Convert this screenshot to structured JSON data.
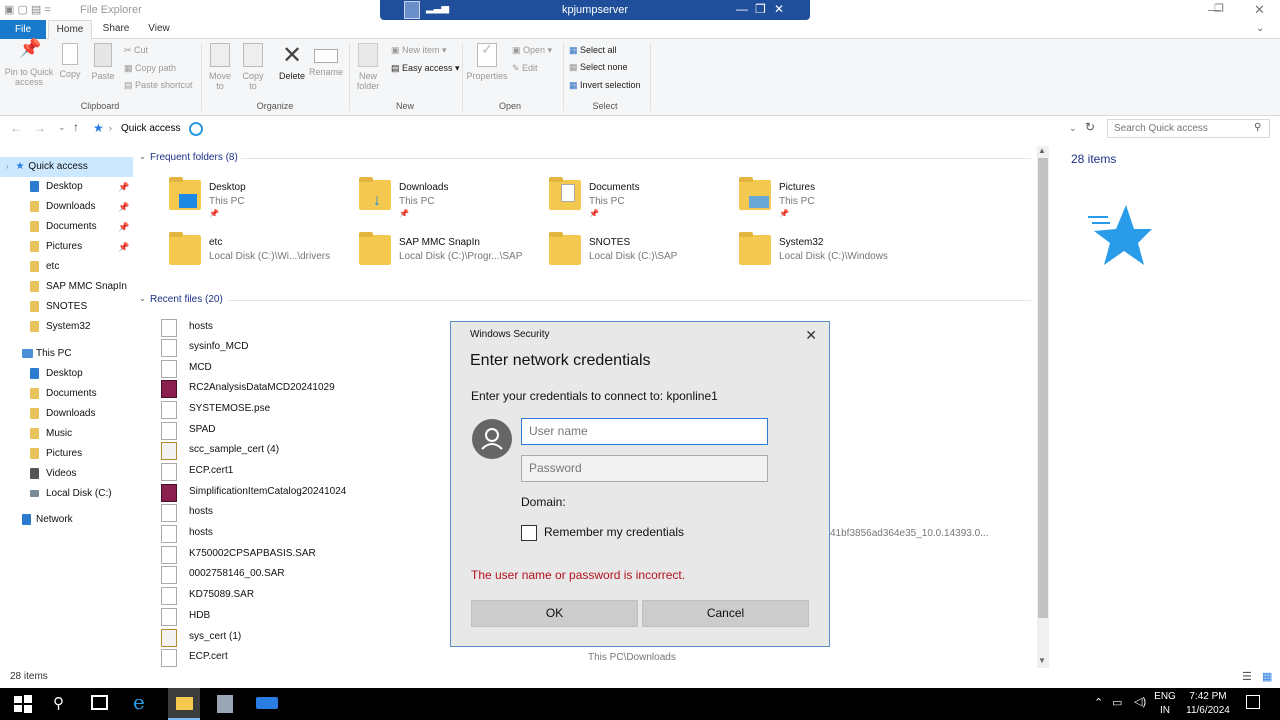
{
  "window": {
    "title": "File Explorer",
    "remote_title": "kpjumpserver"
  },
  "ribbon_tabs": [
    "File",
    "Home",
    "Share",
    "View"
  ],
  "ribbon": {
    "clipboard": {
      "pin": "Pin to Quick access",
      "copy": "Copy",
      "paste": "Paste",
      "cut": "Cut",
      "copy_path": "Copy path",
      "paste_shortcut": "Paste shortcut",
      "label": "Clipboard"
    },
    "organize": {
      "move_to": "Move to",
      "copy_to": "Copy to",
      "delete": "Delete",
      "rename": "Rename",
      "label": "Organize"
    },
    "new": {
      "new_folder": "New folder",
      "new_item": "New item",
      "easy_access": "Easy access",
      "label": "New"
    },
    "open": {
      "properties": "Properties",
      "open": "Open",
      "edit": "Edit",
      "label": "Open"
    },
    "select": {
      "select_all": "Select all",
      "select_none": "Select none",
      "invert": "Invert selection",
      "label": "Select"
    }
  },
  "address": {
    "path": "Quick access",
    "search_placeholder": "Search Quick access"
  },
  "nav": {
    "quick_access": "Quick access",
    "quick_items": [
      "Desktop",
      "Downloads",
      "Documents",
      "Pictures",
      "etc",
      "SAP MMC SnapIn",
      "SNOTES",
      "System32"
    ],
    "this_pc": "This PC",
    "pc_items": [
      "Desktop",
      "Documents",
      "Downloads",
      "Music",
      "Pictures",
      "Videos",
      "Local Disk (C:)"
    ],
    "network": "Network"
  },
  "frequent": {
    "header": "Frequent folders (8)",
    "items": [
      {
        "name": "Desktop",
        "loc": "This PC"
      },
      {
        "name": "Downloads",
        "loc": "This PC"
      },
      {
        "name": "Documents",
        "loc": "This PC"
      },
      {
        "name": "Pictures",
        "loc": "This PC"
      },
      {
        "name": "etc",
        "loc": "Local Disk (C:)\\Wi...\\drivers"
      },
      {
        "name": "SAP MMC SnapIn",
        "loc": "Local Disk (C:)\\Progr...\\SAP"
      },
      {
        "name": "SNOTES",
        "loc": "Local Disk (C:)\\SAP"
      },
      {
        "name": "System32",
        "loc": "Local Disk (C:)\\Windows"
      }
    ]
  },
  "recent": {
    "header": "Recent files (20)",
    "files": [
      "hosts",
      "sysinfo_MCD",
      "MCD",
      "RC2AnalysisDataMCD20241029",
      "SYSTEMOSE.pse",
      "SPAD",
      "scc_sample_cert (4)",
      "ECP.cert1",
      "SimplificationItemCatalog20241024",
      "hosts",
      "hosts",
      "K750002CPSAPBASIS.SAR",
      "0002758146_00.SAR",
      "KD75089.SAR",
      "HDB",
      "sys_cert (1)",
      "ECP.cert"
    ],
    "partial_path": "41bf3856ad364e35_10.0.14393.0...",
    "bottom_path": "This PC\\Downloads"
  },
  "details": {
    "count": "28 items"
  },
  "status": {
    "count": "28 items"
  },
  "dialog": {
    "header": "Windows Security",
    "title": "Enter network credentials",
    "subtitle": "Enter your credentials to connect to: kponline1",
    "username_placeholder": "User name",
    "password_placeholder": "Password",
    "domain_label": "Domain:",
    "remember_label": "Remember my credentials",
    "error": "The user name or password is incorrect.",
    "ok": "OK",
    "cancel": "Cancel"
  },
  "taskbar": {
    "lang": "ENG",
    "region": "IN",
    "time": "7:42 PM",
    "date": "11/6/2024"
  }
}
